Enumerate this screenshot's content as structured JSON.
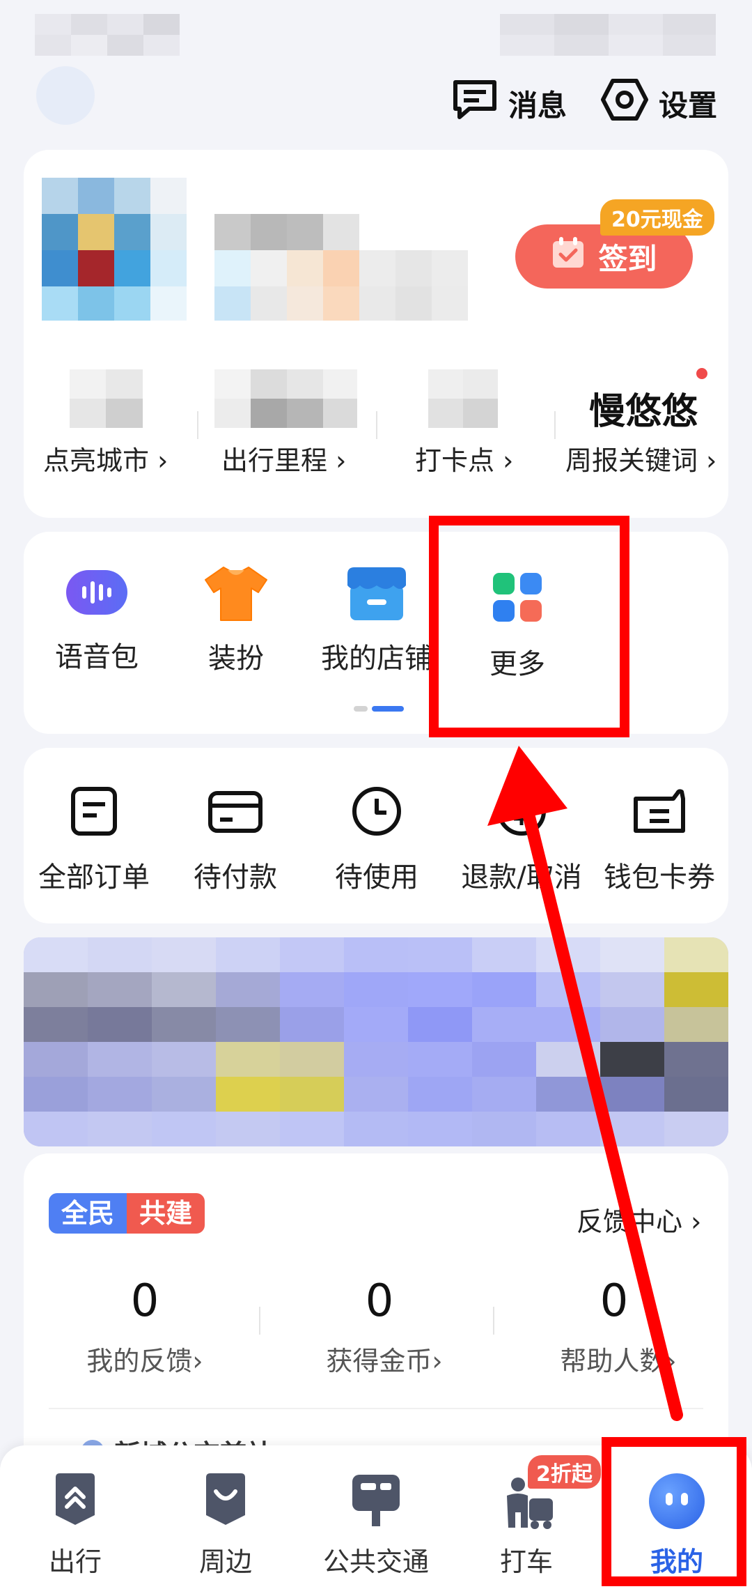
{
  "topbar": {
    "messages_label": "消息",
    "settings_label": "设置"
  },
  "profile": {
    "checkin_label": "签到",
    "checkin_badge": "20元现金",
    "nickname": "慢悠悠",
    "stats": [
      {
        "label": "点亮城市 ›"
      },
      {
        "label": "出行里程 ›"
      },
      {
        "label": "打卡点 ›"
      },
      {
        "label": "周报关键词 ›"
      }
    ]
  },
  "tools": {
    "items": [
      {
        "label": "语音包",
        "icon": "voice-pack-icon"
      },
      {
        "label": "装扮",
        "icon": "tshirt-icon"
      },
      {
        "label": "我的店铺",
        "icon": "store-icon"
      },
      {
        "label": "更多",
        "icon": "grid-more-icon"
      }
    ]
  },
  "orders": {
    "items": [
      {
        "label": "全部订单",
        "icon": "order-list-icon"
      },
      {
        "label": "待付款",
        "icon": "card-icon"
      },
      {
        "label": "待使用",
        "icon": "clock-icon"
      },
      {
        "label": "退款/取消",
        "icon": "yen-icon"
      },
      {
        "label": "钱包卡券",
        "icon": "wallet-icon"
      }
    ]
  },
  "feedback": {
    "badge_left": "全民",
    "badge_right": "共建",
    "center_link": "反馈中心 ›",
    "stats": [
      {
        "value": "0",
        "label": "我的反馈›"
      },
      {
        "value": "0",
        "label": "获得金币›"
      },
      {
        "value": "0",
        "label": "帮助人数›"
      }
    ],
    "peek_text": "新城公交首站"
  },
  "bottom_nav": {
    "items": [
      {
        "label": "出行",
        "icon": "travel-icon"
      },
      {
        "label": "周边",
        "icon": "nearby-icon"
      },
      {
        "label": "公共交通",
        "icon": "bus-icon"
      },
      {
        "label": "打车",
        "icon": "taxi-icon"
      },
      {
        "label": "我的",
        "icon": "avatar-icon"
      }
    ],
    "taxi_badge": "2折起"
  },
  "colors": {
    "accent_blue": "#3b78f1",
    "checkin_red": "#f4665b",
    "annotation_red": "#ff0000"
  }
}
